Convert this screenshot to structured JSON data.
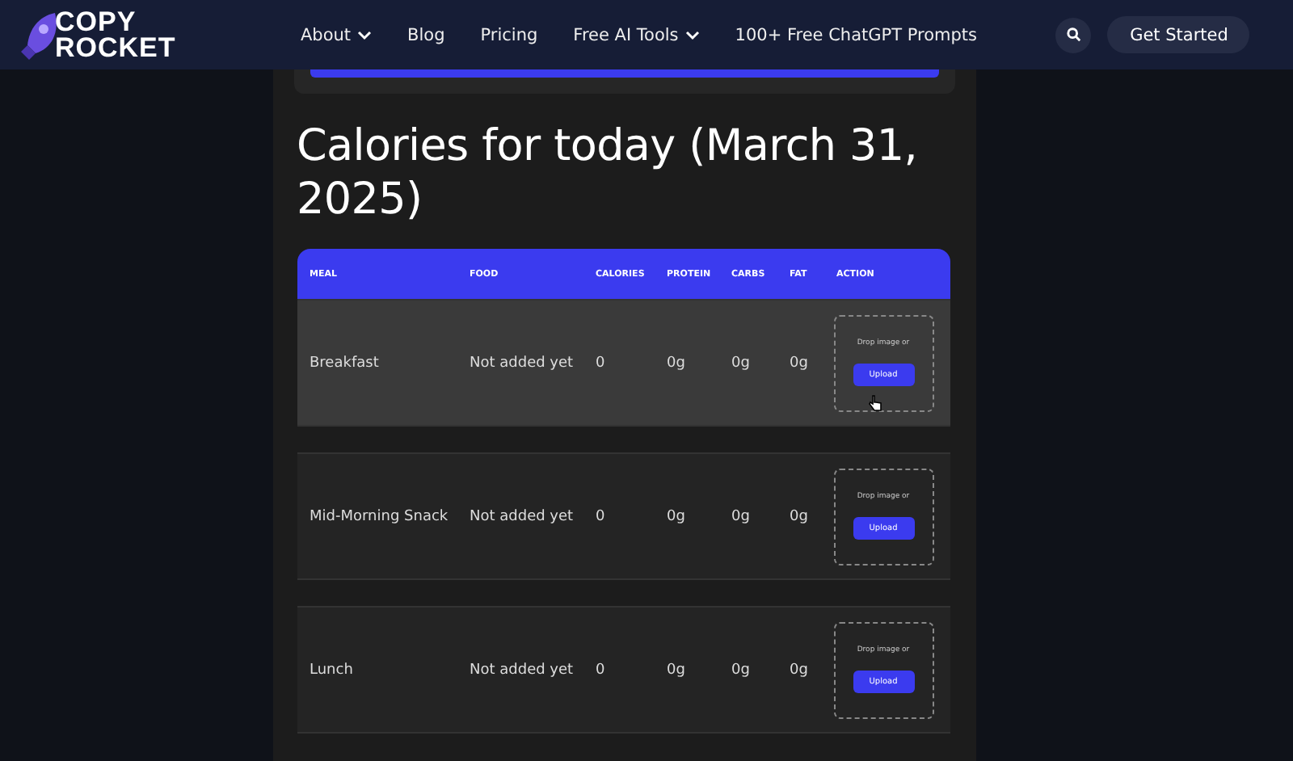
{
  "header": {
    "logo": [
      "COPY",
      "ROCKET"
    ],
    "nav": [
      {
        "label": "About",
        "dropdown": true
      },
      {
        "label": "Blog",
        "dropdown": false
      },
      {
        "label": "Pricing",
        "dropdown": false
      },
      {
        "label": "Free AI Tools",
        "dropdown": true
      },
      {
        "label": "100+ Free ChatGPT Prompts",
        "dropdown": false
      }
    ],
    "cta": "Get Started"
  },
  "title": "Calories for today (March 31, 2025)",
  "table": {
    "columns": [
      "MEAL",
      "FOOD",
      "CALORIES",
      "PROTEIN",
      "CARBS",
      "FAT",
      "ACTION"
    ],
    "rows": [
      {
        "meal": "Breakfast",
        "food": "Not added yet",
        "calories": "0",
        "protein": "0g",
        "carbs": "0g",
        "fat": "0g",
        "drop_text": "Drop image or",
        "button": "Upload",
        "hovered": true
      },
      {
        "meal": "Mid-Morning Snack",
        "food": "Not added yet",
        "calories": "0",
        "protein": "0g",
        "carbs": "0g",
        "fat": "0g",
        "drop_text": "Drop image or",
        "button": "Upload",
        "hovered": false
      },
      {
        "meal": "Lunch",
        "food": "Not added yet",
        "calories": "0",
        "protein": "0g",
        "carbs": "0g",
        "fat": "0g",
        "drop_text": "Drop image or",
        "button": "Upload",
        "hovered": false
      }
    ]
  }
}
